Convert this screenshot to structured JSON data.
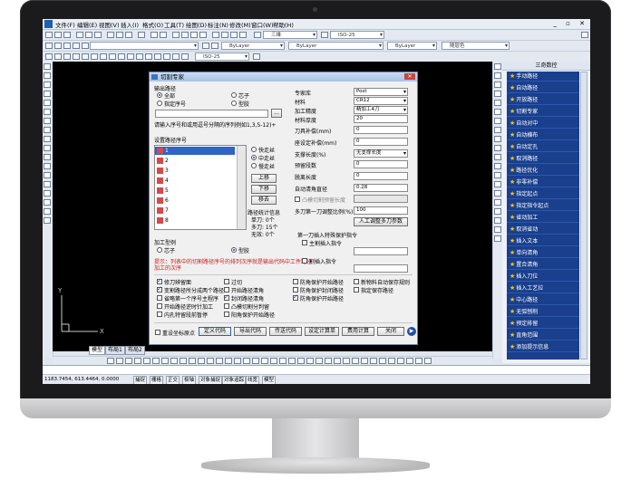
{
  "menu": [
    "文件(F)",
    "编辑(E)",
    "视图(V)",
    "插入(I)",
    "格式(O)",
    "工具(T)",
    "绘图(D)",
    "标注(N)",
    "修改(M)",
    "窗口(W)",
    "帮助(H)"
  ],
  "toolbar": {
    "style_combo": "三维",
    "dimstyle_combo": "ISO-25",
    "layer_combo": "ByLayer",
    "linetype_combo": "ByLayer",
    "lineweight_combo": "ByLayer",
    "color_combo": "随层色",
    "textstyle_combo": "ISO-25"
  },
  "dialog": {
    "title": "切割专家",
    "close_label": "✕",
    "output_path_label": "输出路径",
    "path_all": "全部",
    "path_core": "芯子",
    "path_specified": "指定序号",
    "path_die": "型胶",
    "browse_label": "...",
    "seq_hint": "请输入序号和或用逗号分隔的序列例如1,3,5-12)+",
    "set_path_label": "设置路径序号",
    "paths": [
      "1",
      "2",
      "3",
      "4",
      "5",
      "6",
      "7",
      "8"
    ],
    "speed_fast": "快走丝",
    "speed_mid": "中走丝",
    "speed_slow": "慢走丝",
    "move_up": "上移",
    "move_down": "下移",
    "remove": "移去",
    "path_info_title": "路径统计信息",
    "info_single": "单刀: 0个",
    "info_multi": "多刀: 15个",
    "info_none": "无效: 0个",
    "process_type_label": "加工型例",
    "proc_core": "芯子",
    "proc_die": "型胶",
    "hint_text": "提示：列表中的切割路径序号的排列次序就是输出代码中工件路径加工的次序",
    "expert_lib_label": "专家库",
    "expert_lib_value": "Post",
    "material_label": "材料",
    "material_value": "CR12",
    "precision_label": "加工精度",
    "precision_value": "精加工4刀",
    "thickness_label": "材料厚度",
    "thickness_value": "20",
    "tool_comp_label": "刀具补偿(mm)",
    "tool_comp_value": "0",
    "angle_comp_label": "座设定补偿(mm)",
    "angle_comp_value": "0",
    "support_len_label": "支撑长度(%)",
    "support_len_value": "无支撑长度",
    "reserve_label": "预留段数",
    "reserve_value": "0",
    "detach_label": "脱离长度",
    "detach_value": "0",
    "auto_round_label": "自动清角直径",
    "auto_round_value": "0.28",
    "split_label": "凸模切割预留长度",
    "split_value": "",
    "multi_ratio_label": "多刀第一刀调整比例(%)",
    "multi_ratio_value": "100",
    "manual_adjust": "人工调整多刀参数",
    "first_cut_title": "第一刀插入特殊保护指令",
    "insert_instr_1": "主割插入指令",
    "insert_instr_2": "割插入指令",
    "opts": [
      "修刀辨留面",
      "过切",
      "防角保护开始路径",
      "新物料自动保存规则",
      "变割路径所分成两个路径",
      "开始路径清角",
      "防角保护封闭路径",
      "指定保存路径",
      "省略第一个序号主程序",
      "封闭路径清角",
      "防角保护开始路径",
      "开始路径逆时针加工",
      "凸模切割分判留",
      "内孔特留段前暂停",
      "阳角保护开始路径"
    ],
    "btn_reset_origin": "重设坐标原点",
    "btn_define_code": "定义代码",
    "btn_export_code": "导出代码",
    "btn_send_code": "传送代码",
    "btn_settings": "设定计算单",
    "btn_cost": "费用计算",
    "btn_close": "关闭"
  },
  "panel": {
    "title": "三奇数控",
    "items": [
      "手动路径",
      "自动路径",
      "开放路径",
      "切割专家",
      "自动对中",
      "自动横布",
      "自动定孔",
      "取消路径",
      "路径优化",
      "非零补偿",
      "指定起点",
      "指定指令起点",
      "省动加工",
      "取消省动",
      "插入文本",
      "单向清角",
      "置合清角",
      "插入刀位",
      "插入工艺拉",
      "中心路径",
      "无弧刨削",
      "预定排留",
      "直角范围",
      "添加提示信息"
    ]
  },
  "tabs": [
    "模型",
    "布局1",
    "布局2"
  ],
  "statusbar": {
    "coords": "1183.7454, 613.4464, 0.0000",
    "buttons": [
      "捕捉",
      "栅格",
      "正交",
      "极轴",
      "对象捕捉",
      "对象追踪",
      "线宽",
      "模型"
    ]
  }
}
